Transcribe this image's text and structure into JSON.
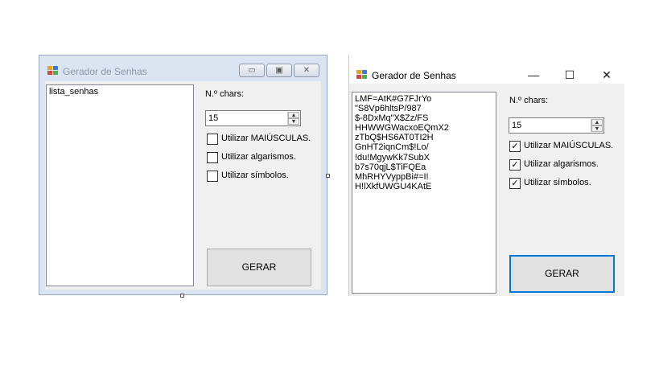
{
  "designer_window": {
    "title": "Gerador de Senhas",
    "listbox_items": [
      "lista_senhas"
    ],
    "nchars_label": "N.º chars:",
    "nchars_value": "15",
    "checkboxes": [
      {
        "label": "Utilizar MAIÚSCULAS.",
        "checked": false
      },
      {
        "label": "Utilizar algarismos.",
        "checked": false
      },
      {
        "label": "Utilizar símbolos.",
        "checked": false
      }
    ],
    "generate_button": "GERAR",
    "controls": {
      "minimize": "▭",
      "maximize": "▣",
      "close": "✕"
    }
  },
  "running_window": {
    "title": "Gerador de Senhas",
    "listbox_items": [
      "LMF=AtK#G7FJrYo",
      "\"S8Vp6hltsP/987",
      "$-8DxMq\"X$Zz/FS",
      "HHWWGWacxoEQmX2",
      "zTbQ$HS6AT0TI2H",
      "GnHT2iqnCm$!Lo/",
      "!du!MgywKk7SubX",
      "b7s70qjL$TiFQEa",
      "MhRHYVyppBi#=I!",
      "H!lXkfUWGU4KAtE"
    ],
    "nchars_label": "N.º chars:",
    "nchars_value": "15",
    "checkboxes": [
      {
        "label": "Utilizar MAIÚSCULAS.",
        "checked": true
      },
      {
        "label": "Utilizar algarismos.",
        "checked": true
      },
      {
        "label": "Utilizar símbolos.",
        "checked": true
      }
    ],
    "generate_button": "GERAR",
    "controls": {
      "minimize": "—",
      "maximize": "☐",
      "close": "✕"
    }
  },
  "check_mark": "✓",
  "spin_up": "▲",
  "spin_down": "▼",
  "colors": {
    "accent": "#0078d7",
    "designer_bg": "#dbe5f1",
    "form_bg": "#f0f0f0"
  }
}
